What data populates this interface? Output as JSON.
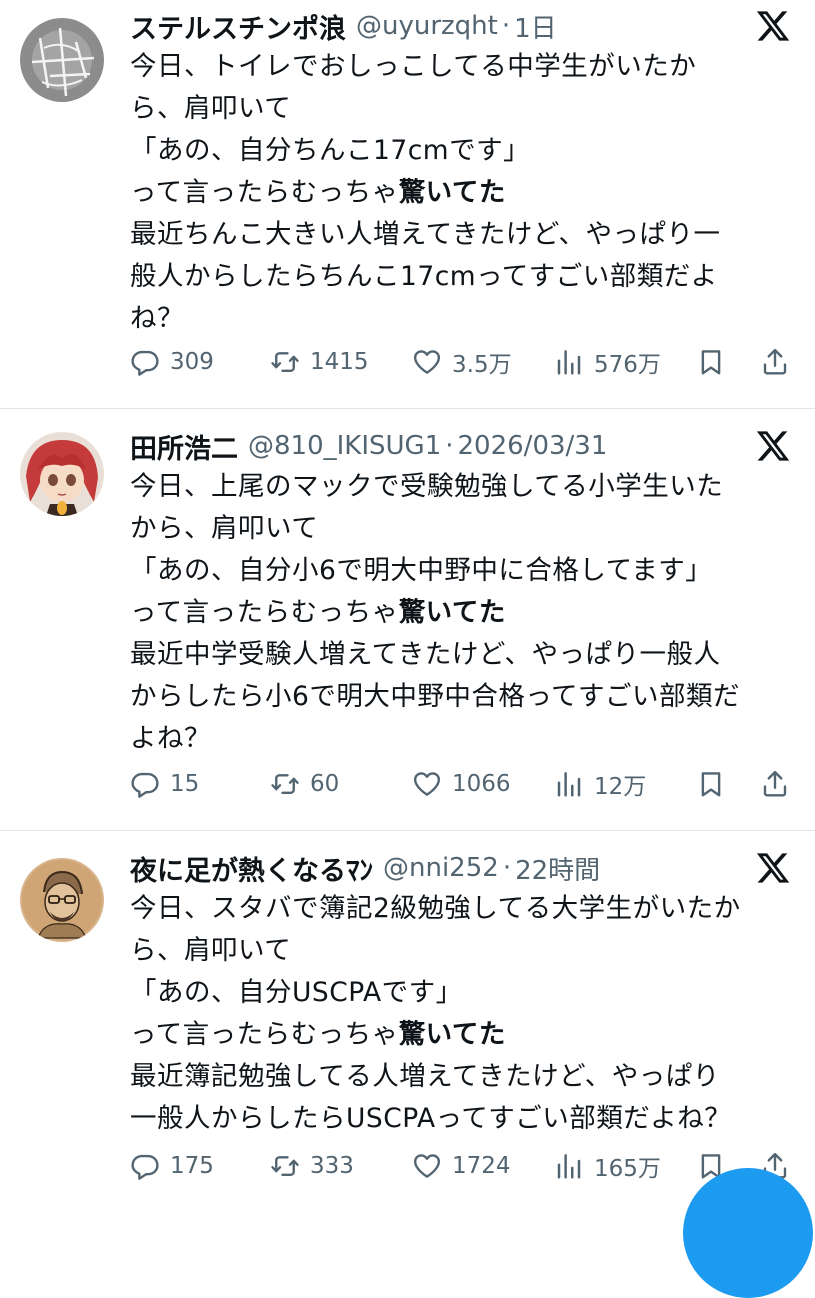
{
  "tweets": [
    {
      "name": "ステルスチンポ浪",
      "handle": "@uyurzqht",
      "dot": "·",
      "time": "1日",
      "lines": [
        "今日、トイレでおしっこしてる中学生がいたか",
        "ら、肩叩いて",
        "「あの、自分ちんこ17cmです」",
        "って言ったらむっちゃ",
        "最近ちんこ大きい人増えてきたけど、やっぱり一",
        "般人からしたらちんこ17cmってすごい部類だよ",
        "ね？"
      ],
      "bold": "驚いてた",
      "replies": "309",
      "retweets": "1415",
      "likes": "3.5万",
      "views": "576万"
    },
    {
      "name": "田所浩二",
      "handle": "@810_IKISUG1",
      "dot": "·",
      "time": "2026/03/31",
      "lines": [
        "今日、上尾のマックで受験勉強してる小学生いた",
        "から、肩叩いて",
        "「あの、自分小6で明大中野中に合格してます」",
        "って言ったらむっちゃ",
        "最近中学受験人増えてきたけど、やっぱり一般人",
        "からしたら小6で明大中野中合格ってすごい部類だ",
        "よね？"
      ],
      "bold": "驚いてた",
      "replies": "15",
      "retweets": "60",
      "likes": "1066",
      "views": "12万"
    },
    {
      "name": "夜に足が熱くなるﾏﾝ",
      "handle": "@nni252",
      "dot": "·",
      "time": "22時間",
      "lines": [
        "今日、スタバで簿記2級勉強してる大学生がいたか",
        "ら、肩叩いて",
        "「あの、自分USCPAです」",
        "って言ったらむっちゃ",
        "最近簿記勉強してる人増えてきたけど、やっぱり",
        "一般人からしたらUSCPAってすごい部類だよね？"
      ],
      "bold": "驚いてた",
      "replies": "175",
      "retweets": "333",
      "likes": "1724",
      "views": "165万"
    }
  ],
  "icons": {
    "reply": "reply-icon",
    "retweet": "retweet-icon",
    "like": "heart-icon",
    "views": "views-icon",
    "bookmark": "bookmark-icon",
    "share": "share-icon",
    "platform": "x-logo-icon"
  },
  "colors": {
    "text": "#0f1419",
    "secondary": "#536471",
    "accent": "#1d9bf0",
    "divider": "#e1e6ea"
  }
}
